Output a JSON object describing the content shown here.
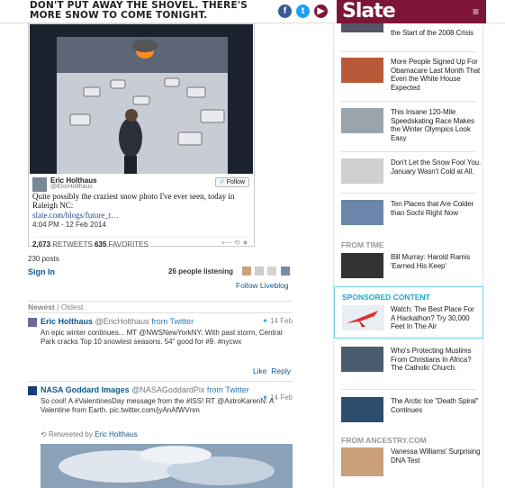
{
  "header": {
    "headline": "Don't put away the shovel. There's more snow to come tonight.",
    "social": [
      {
        "name": "facebook",
        "glyph": "f",
        "color": "#3b5998"
      },
      {
        "name": "twitter",
        "glyph": "t",
        "color": "#1da1f2"
      },
      {
        "name": "youtube",
        "glyph": "▶",
        "color": "#7d1536"
      }
    ],
    "logo": "Slate",
    "menu_icon": "≡"
  },
  "embedded_tweet": {
    "name": "Eric Holthaus",
    "handle": "@EricHolthaus",
    "follow_label": "Follow",
    "text": "Quite possibly the craziest snow photo I've ever seen, today in Raleigh NC:",
    "link": "slate.com/blogs/future_t…",
    "time": "4:04 PM - 12 Feb 2014",
    "retweets": "2,073",
    "retweets_label": "RETWEETS",
    "favorites": "635",
    "favorites_label": "FAVORITES",
    "actions": "⟵ ⟲ ★"
  },
  "liveblog": {
    "posts_count": "230 posts",
    "sign_in": "Sign In",
    "listening": "26 people listening",
    "follow": "Follow Liveblog",
    "tab_newest": "Newest",
    "tab_sep": "|",
    "tab_oldest": "Oldest"
  },
  "posts": [
    {
      "name": "Eric Holthaus",
      "handle": "@EricHolthaus",
      "from": "from Twitter",
      "date": "14 Feb",
      "text": "An epic winter continues... MT @NWSNewYorkNY: With past storm, Central Park cracks Top 10 snowiest seasons. 54\" good for #9. #nycwx",
      "like": "Like",
      "reply": "Reply"
    },
    {
      "name": "NASA Goddard Images",
      "handle": "@NASAGoddardPix",
      "from": "from Twitter",
      "date": "14 Feb",
      "text": "So cool! A #ValentinesDay message from the #ISS! RT @AstroKarenN: A Valentine from Earth. pic.twitter.com/jyAnAfWVnm",
      "retweeted_by_label": "Retweeted by",
      "retweeted_by": "Eric Holthaus"
    }
  ],
  "sidebar": {
    "items": [
      {
        "title": "the Start of the 2008 Crisis"
      },
      {
        "title": "More People Signed Up For Obamacare Last Month That Even the White House Expected"
      },
      {
        "title": "This Insane 120-Mile Speedskating Race Makes the Winter Olympics Look Easy"
      },
      {
        "title": "Don't Let the Snow Fool You. January Wasn't Cold at All."
      },
      {
        "title": "Ten Places that Are Colder than Sochi Right Now"
      }
    ],
    "from_time_label": "From Time",
    "from_time_item": "Bill Murray: Harold Ramis 'Earned His Keep'",
    "sponsored_label": "Sponsored Content",
    "sponsored_item": "Watch: The Best Place For A Hackathon? Try 30,000 Feet In The Air",
    "items2": [
      {
        "title": "Who's Protecting Muslims From Christians In Africa? The Catholic Church."
      },
      {
        "title": "The Arctic Ice \"Death Spiral\" Continues"
      }
    ],
    "ancestry_label": "From Ancestry.com",
    "ancestry_item": "Vanessa Williams' Surprising DNA Test"
  }
}
